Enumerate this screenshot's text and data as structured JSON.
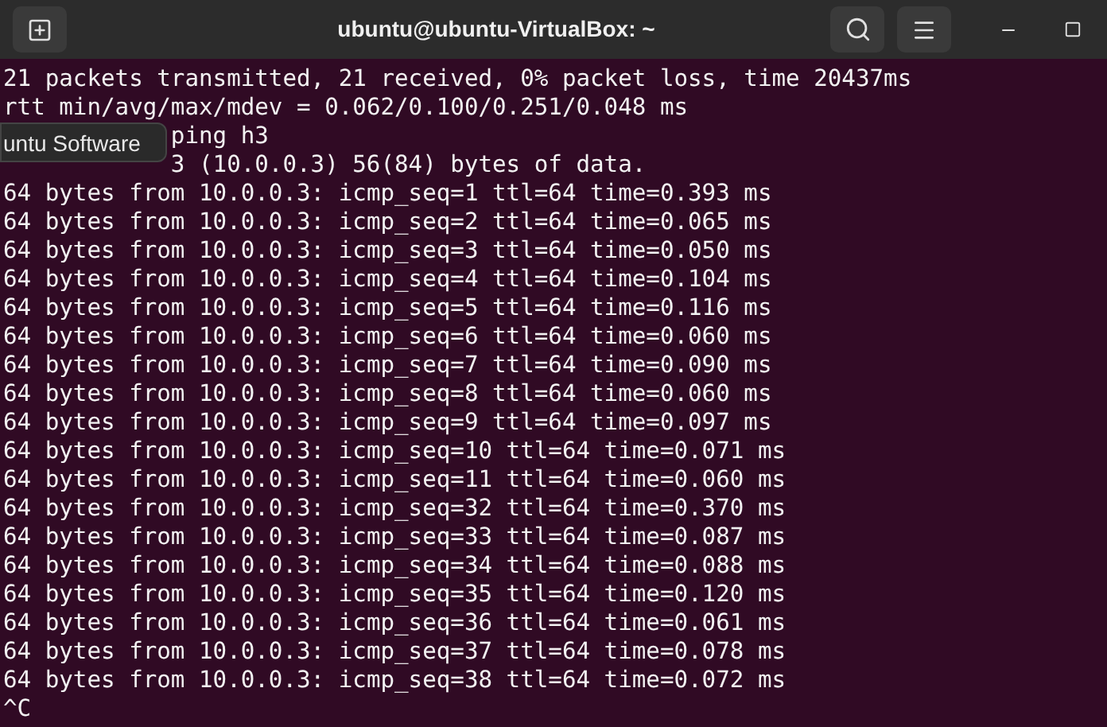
{
  "window": {
    "title": "ubuntu@ubuntu-VirtualBox: ~"
  },
  "tooltip": "untu Software",
  "terminal_lines": [
    "21 packets transmitted, 21 received, 0% packet loss, time 20437ms",
    "rtt min/avg/max/mdev = 0.062/0.100/0.251/0.048 ms",
    {
      "kind": "covered",
      "text": "ping h3"
    },
    {
      "kind": "covered",
      "text": "3 (10.0.0.3) 56(84) bytes of data."
    },
    "64 bytes from 10.0.0.3: icmp_seq=1 ttl=64 time=0.393 ms",
    "64 bytes from 10.0.0.3: icmp_seq=2 ttl=64 time=0.065 ms",
    "64 bytes from 10.0.0.3: icmp_seq=3 ttl=64 time=0.050 ms",
    "64 bytes from 10.0.0.3: icmp_seq=4 ttl=64 time=0.104 ms",
    "64 bytes from 10.0.0.3: icmp_seq=5 ttl=64 time=0.116 ms",
    "64 bytes from 10.0.0.3: icmp_seq=6 ttl=64 time=0.060 ms",
    "64 bytes from 10.0.0.3: icmp_seq=7 ttl=64 time=0.090 ms",
    "64 bytes from 10.0.0.3: icmp_seq=8 ttl=64 time=0.060 ms",
    "64 bytes from 10.0.0.3: icmp_seq=9 ttl=64 time=0.097 ms",
    "64 bytes from 10.0.0.3: icmp_seq=10 ttl=64 time=0.071 ms",
    "64 bytes from 10.0.0.3: icmp_seq=11 ttl=64 time=0.060 ms",
    "64 bytes from 10.0.0.3: icmp_seq=32 ttl=64 time=0.370 ms",
    "64 bytes from 10.0.0.3: icmp_seq=33 ttl=64 time=0.087 ms",
    "64 bytes from 10.0.0.3: icmp_seq=34 ttl=64 time=0.088 ms",
    "64 bytes from 10.0.0.3: icmp_seq=35 ttl=64 time=0.120 ms",
    "64 bytes from 10.0.0.3: icmp_seq=36 ttl=64 time=0.061 ms",
    "64 bytes from 10.0.0.3: icmp_seq=37 ttl=64 time=0.078 ms",
    "64 bytes from 10.0.0.3: icmp_seq=38 ttl=64 time=0.072 ms",
    "^C"
  ]
}
